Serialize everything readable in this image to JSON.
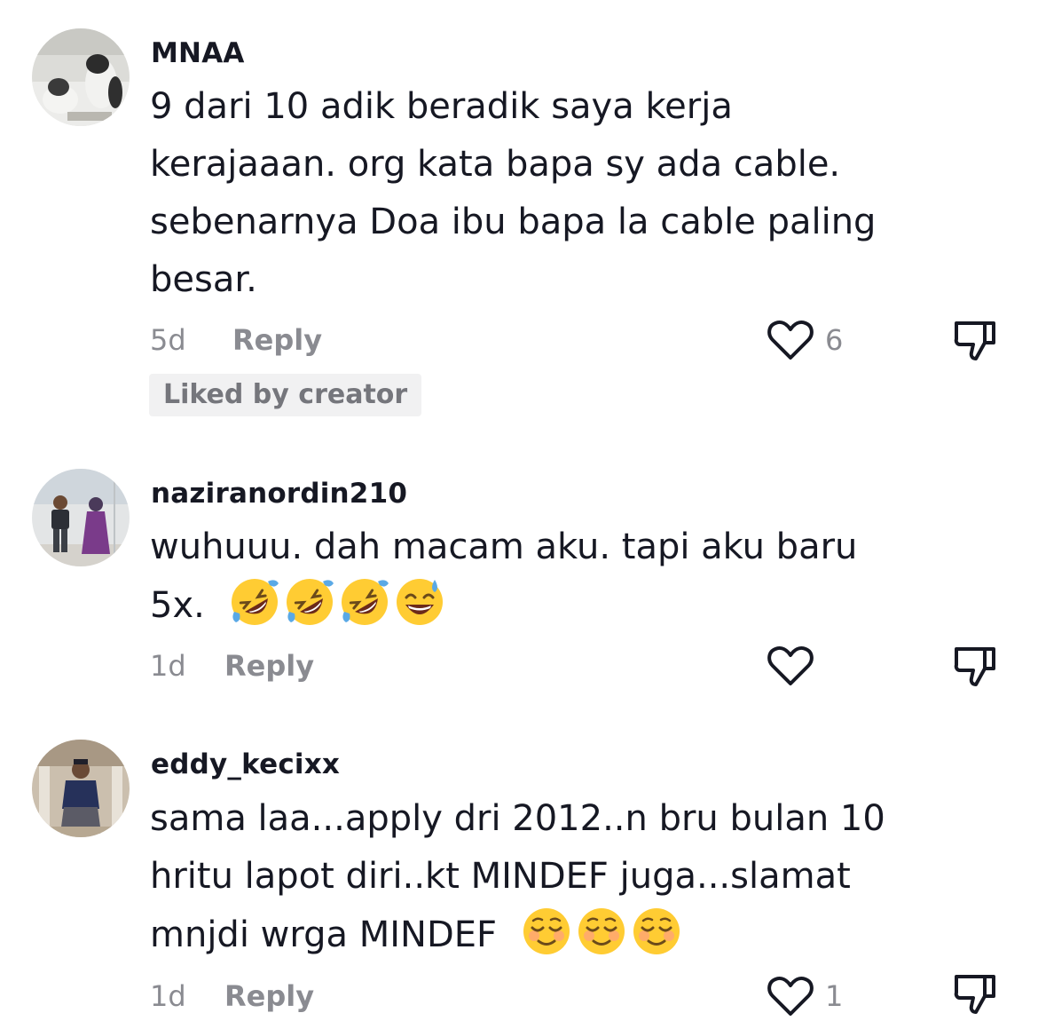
{
  "comments": [
    {
      "username": "MNAA",
      "lines": [
        "9 dari 10 adik beradik saya kerja",
        "kerajaaan. org kata bapa sy ada cable.",
        "sebenarnya Doa ibu bapa la cable paling",
        "besar."
      ],
      "time": "5d",
      "reply_label": "Reply",
      "like_count": "6",
      "badge": "Liked by creator"
    },
    {
      "username": "naziranordin210",
      "lines": [
        "wuhuuu. dah macam aku. tapi aku baru",
        "5x."
      ],
      "emojis": [
        "rofl-emoji",
        "rofl-emoji",
        "rofl-emoji",
        "sweat-smile-emoji"
      ],
      "time": "1d",
      "reply_label": "Reply",
      "like_count": ""
    },
    {
      "username": "eddy_kecixx",
      "lines": [
        "sama laa...apply dri 2012..n bru bulan 10",
        "hritu lapot diri..kt MINDEF juga...slamat",
        "mnjdi wrga MINDEF"
      ],
      "emojis": [
        "relieved-smile-emoji",
        "relieved-smile-emoji",
        "relieved-smile-emoji"
      ],
      "time": "1d",
      "reply_label": "Reply",
      "like_count": "1"
    }
  ],
  "icons": {
    "like": "heart-outline-icon",
    "dislike": "thumbs-down-outline-icon"
  },
  "colors": {
    "text": "#161823",
    "meta": "#8a8b91",
    "badge_bg": "#f1f1f2",
    "emoji_face": "#ffcc33"
  }
}
